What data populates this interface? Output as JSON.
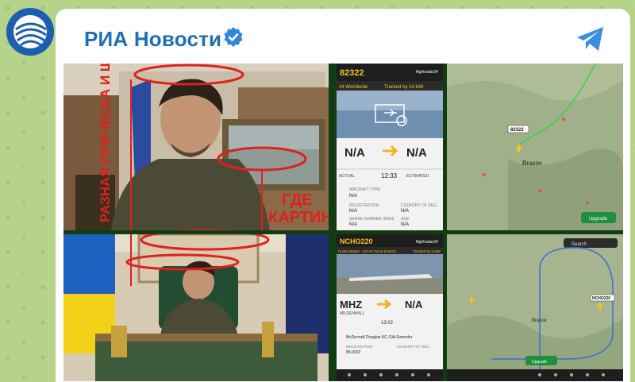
{
  "channel": {
    "name": "РИА Новости",
    "avatar_icon": "ria-logo-icon",
    "verified_icon": "verified-badge-icon",
    "share_icon": "telegram-share-icon",
    "accent": "#1f6fb5"
  },
  "collage": {
    "annotation_left": "РАЗНАЯ ПРИЧЕСКА И ЩЕТИНА",
    "annotation_question_line1": "ГДЕ",
    "annotation_question_line2": "КАРТИНА?",
    "annotation_color": "#e0201e",
    "flight1": {
      "flight_no": "82322",
      "tracked_label": "#4 Worldwide",
      "tracked_by": "Tracked by 14,648",
      "origin": "N/A",
      "destination": "N/A",
      "actual_label": "ACTUAL",
      "time": "12:33",
      "estimated_label": "ESTIMATED",
      "aircraft_type_label": "AIRCRAFT TYPE",
      "aircraft_type": "N/A",
      "registration_label": "REGISTRATION",
      "registration": "N/A",
      "country_label": "COUNTRY OF REG.",
      "country": "N/A",
      "serial_label": "SERIAL NUMBER (MSN)",
      "serial": "N/A",
      "age_label": "AGE",
      "age": "N/A",
      "brand": "flightradar24"
    },
    "map1": {
      "label": "82322",
      "city": "Brasov",
      "upgrade": "Upgrade"
    },
    "flight2": {
      "flight_no": "NCHO220",
      "operator": "United States - US Air Force (USAF)",
      "tracked_by": "Tracked by 9,448",
      "origin": "MHZ",
      "origin_name": "MILDENHALL",
      "destination": "N/A",
      "time": "13:02",
      "aircraft": "McDonnell Douglas KC-10A Extender",
      "registration_label": "REGISTRATION",
      "registration": "85-0032",
      "country_label": "COUNTRY OF REG.",
      "brand": "flightradar24"
    },
    "map2": {
      "label": "NCHO220",
      "city": "Brasov",
      "search": "Search",
      "upgrade": "Upgrade"
    }
  }
}
